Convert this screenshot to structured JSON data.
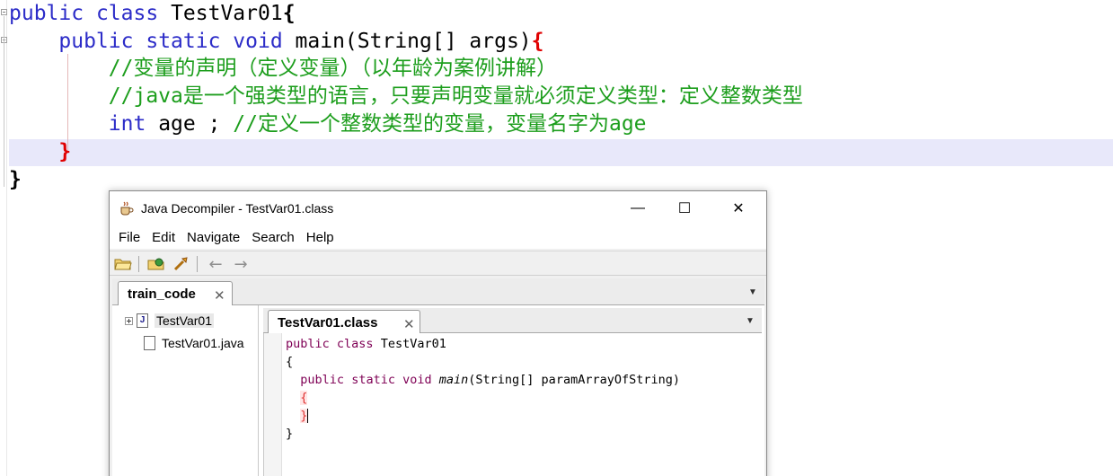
{
  "editor": {
    "lines": {
      "l1": {
        "kw1": "public",
        "kw2": "class",
        "name": "TestVar01",
        "brace": "{"
      },
      "l2": {
        "kw1": "public",
        "kw2": "static",
        "kw3": "void",
        "rest": "main(String[] args)",
        "brace": "{"
      },
      "l3": {
        "comment": "//变量的声明（定义变量）（以年龄为案例讲解）"
      },
      "l4": {
        "comment": "//java是一个强类型的语言，只要声明变量就必须定义类型：定义整数类型"
      },
      "l5": {
        "type": "int",
        "code": "age ;",
        "comment": "//定义一个整数类型的变量，变量名字为age"
      },
      "l6": {
        "brace": "}"
      },
      "l7": {
        "brace": "}"
      }
    }
  },
  "jd": {
    "title": "Java Decompiler - TestVar01.class",
    "icons": {
      "app": "coffee-cup-icon"
    },
    "window_buttons": {
      "minimize": "—",
      "maximize": "☐",
      "close": "✕"
    },
    "menu": [
      "File",
      "Edit",
      "Navigate",
      "Search",
      "Help"
    ],
    "toolbar": {
      "back": "←",
      "forward": "→"
    },
    "outer_tab": {
      "label": "train_code",
      "close": "✕"
    },
    "dropdown": "▼",
    "tree": {
      "root": {
        "icon": "J",
        "label": "TestVar01"
      },
      "child": {
        "label": "TestVar01.java"
      }
    },
    "inner_tab": {
      "label": "TestVar01.class",
      "close": "✕"
    },
    "code": {
      "l1": {
        "kw1": "public",
        "kw2": "class",
        "name": "TestVar01"
      },
      "l2": "{",
      "l3": {
        "kw1": "public",
        "kw2": "static",
        "kw3": "void",
        "method": "main",
        "params": "(String[] paramArrayOfString)"
      },
      "l4": "{",
      "l5": "}",
      "l6": "}"
    }
  }
}
